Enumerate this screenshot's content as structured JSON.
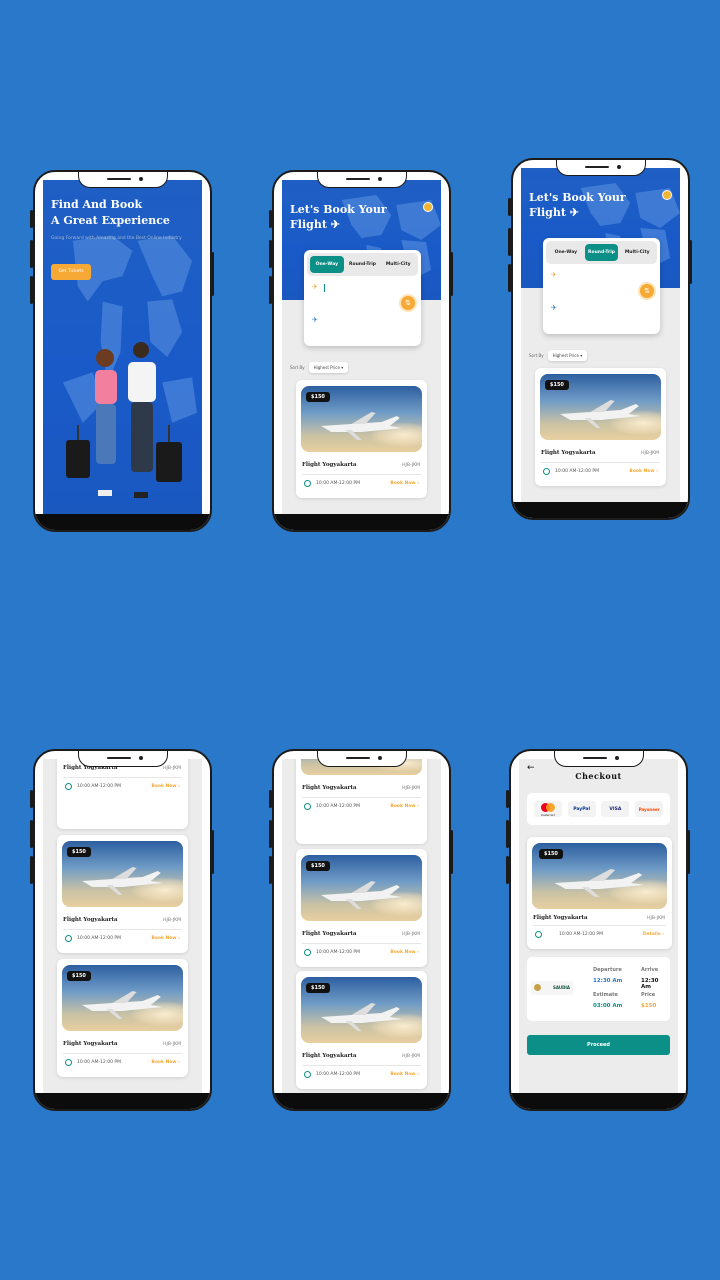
{
  "splash": {
    "title_line1": "Find And Book",
    "title_line2": "A Great Experience",
    "subtitle": "Going Forward with Amazing and the Best Online Industry",
    "cta": "Get Tickets"
  },
  "booking": {
    "title_line1": "Let's Book Your",
    "title_line2": "Flight ✈",
    "tabs": [
      "One-Way",
      "Round-Trip",
      "Multi-City"
    ],
    "sort_label": "Sort By",
    "sort_value": "Highest Price"
  },
  "flight": {
    "price": "$150",
    "name": "Flight Yogyakarta",
    "code": "HJB-JKM",
    "time": "10:00 AM-12:00 PM",
    "book_label": "Book Now",
    "details_label": "Details"
  },
  "checkout": {
    "title": "Checkout",
    "payments": [
      "mastercard",
      "PayPal",
      "VISA",
      "Payoneer"
    ],
    "airline": "SAUDIA",
    "departure_label": "Departure",
    "departure_value": "12:30 Am",
    "arrive_label": "Arrive",
    "arrive_value": "12:30 Am",
    "estimate_label": "Estimate",
    "estimate_value": "03:00 Am",
    "price_label": "Price",
    "price_value": "$150",
    "proceed": "Proceed"
  },
  "colors": {
    "background": "#2a78c9",
    "primary": "#0c8f86",
    "accent": "#f6a934"
  }
}
